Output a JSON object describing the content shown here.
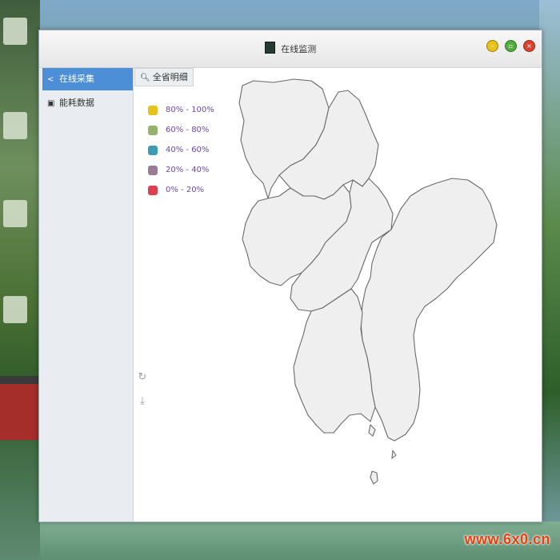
{
  "window": {
    "title": "在线监测"
  },
  "sidebar": {
    "items": [
      {
        "label": "在线采集",
        "icon": "share-icon",
        "active": true
      },
      {
        "label": "能耗数据",
        "icon": "lock-icon",
        "active": false
      }
    ]
  },
  "toolbar": {
    "tab_label": "全省明细",
    "tab_icon": "search-icon"
  },
  "legend": {
    "items": [
      {
        "label": "80%  -  100%",
        "color": "#e6c21d"
      },
      {
        "label": "60%  -  80%",
        "color": "#97b06b"
      },
      {
        "label": "40%  -  60%",
        "color": "#3e9bb6"
      },
      {
        "label": "20%  -  40%",
        "color": "#9b7b93"
      },
      {
        "label": "0%  -  20%",
        "color": "#d9414c"
      }
    ]
  },
  "map_tools": [
    {
      "icon": "refresh-icon"
    },
    {
      "icon": "download-icon"
    }
  ],
  "watermark": "www.6x0.cn",
  "colors": {
    "sidebar_active": "#4d8fd6",
    "region_fill": "#efefef"
  }
}
